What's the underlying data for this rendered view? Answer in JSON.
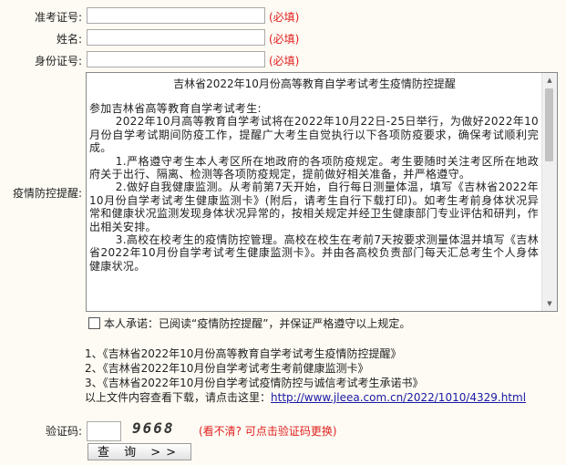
{
  "form": {
    "exam_id_label": "准考证号:",
    "name_label": "姓名:",
    "id_card_label": "身份证号:",
    "required_text": "(必填)",
    "exam_id_value": "",
    "name_value": "",
    "id_card_value": ""
  },
  "notice": {
    "label": "疫情防控提醒:",
    "title": "吉林省2022年10月份高等教育自学考试考生疫情防控提醒",
    "paragraphs": [
      "参加吉林省高等教育自学考试考生:",
      "2022年10月高等教育自学考试将在2022年10月22日-25日举行，为做好2022年10月份自学考试期间防疫工作，提醒广大考生自觉执行以下各项防疫要求，确保考试顺利完成。",
      "1.严格遵守考生本人考区所在地政府的各项防疫规定。考生要随时关注考区所在地政府关于出行、隔离、检测等各项防疫规定，提前做好相关准备，并严格遵守。",
      "2.做好自我健康监测。从考前第7天开始，自行每日测量体温，填写《吉林省2022年10月份自学考试考生健康监测卡》(附后，请考生自行下载打印)。如考生考前身体状况异常和健康状况监测发现身体状况异常的，按相关规定并经卫生健康部门专业评估和研判，作出相关安排。",
      "3.高校在校考生的疫情防控管理。高校在校生在考前7天按要求测量体温并填写《吉林省2022年10月份自学考试考生健康监测卡》。并由各高校负责部门每天汇总考生个人身体健康状况。"
    ]
  },
  "promise": {
    "checked": false,
    "text": "本人承诺：已阅读“疫情防控提醒”，并保证严格遵守以上规定。"
  },
  "docs": {
    "items": [
      "1、《吉林省2022年10月份高等教育自学考试考生疫情防控提醒》",
      "2、《吉林省2022年10月份自学考试考生考前健康监测卡》",
      "3、《吉林省2022年10月份自学考试疫情防控与诚信考试考生承诺书》"
    ],
    "download_prefix": "以上文件内容查看下载，请点击这里：",
    "download_link": "http://www.jleea.com.cn/2022/1010/4329.html"
  },
  "captcha": {
    "label": "验证码:",
    "code": "9668",
    "hint": "(看不清? 可点击验证码更换)",
    "value": ""
  },
  "query_button": {
    "label": "查 询 >>"
  }
}
